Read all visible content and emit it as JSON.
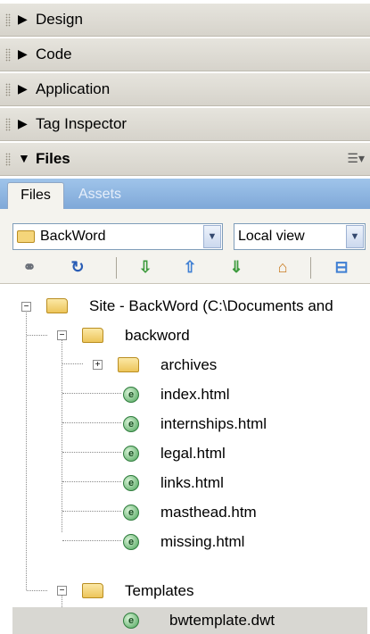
{
  "panels": [
    {
      "label": "Design",
      "expanded": false
    },
    {
      "label": "Code",
      "expanded": false
    },
    {
      "label": "Application",
      "expanded": false
    },
    {
      "label": "Tag Inspector",
      "expanded": false
    },
    {
      "label": "Files",
      "expanded": true
    }
  ],
  "tabs": {
    "files": "Files",
    "assets": "Assets"
  },
  "toolbar": {
    "site_select": "BackWord",
    "view_select": "Local view",
    "icons": [
      "connect-icon",
      "refresh-icon",
      "get-files-icon",
      "put-files-icon",
      "check-out-icon",
      "check-in-icon",
      "expand-icon"
    ]
  },
  "tree": {
    "root": "Site - BackWord (C:\\Documents and",
    "backword": "backword",
    "archives": "archives",
    "files": [
      "index.html",
      "internships.html",
      "legal.html",
      "links.html",
      "masthead.htm",
      "missing.html"
    ],
    "templates": "Templates",
    "template_file": "bwtemplate.dwt"
  },
  "colors": {
    "panel_bar": "#dcd9d0",
    "tab_strip": "#8fb5e1",
    "toolbar_bg": "#f4f3ee",
    "selected_row": "#d8d7d2"
  }
}
